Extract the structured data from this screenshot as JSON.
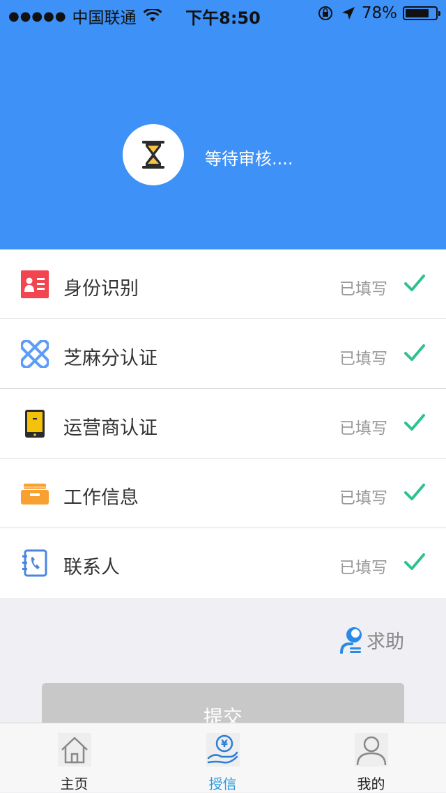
{
  "status_bar": {
    "signal": "●●●●●",
    "carrier": "中国联通",
    "time": "下午8:50",
    "battery": "78%",
    "battery_level": 0.78
  },
  "header": {
    "status_text": "等待审核....",
    "background_color": "#3d91f7",
    "icon": "hourglass-icon"
  },
  "items": [
    {
      "label": "身份识别",
      "state": "已填写",
      "icon": "id-card-icon",
      "icon_color": "#f2454f"
    },
    {
      "label": "芝麻分认证",
      "state": "已填写",
      "icon": "sesame-credit-icon",
      "icon_color": "#5b9df9"
    },
    {
      "label": "运营商认证",
      "state": "已填写",
      "icon": "mobile-phone-icon",
      "icon_color": "#f5c20b"
    },
    {
      "label": "工作信息",
      "state": "已填写",
      "icon": "briefcase-icon",
      "icon_color": "#f8a031"
    },
    {
      "label": "联系人",
      "state": "已填写",
      "icon": "contacts-book-icon",
      "icon_color": "#4a86e0"
    }
  ],
  "check_color": "#2ec28d",
  "help": {
    "label": "求助",
    "icon": "customer-service-icon"
  },
  "submit": {
    "label": "提交"
  },
  "tabbar": [
    {
      "label": "主页",
      "icon": "home-icon",
      "active": false
    },
    {
      "label": "授信",
      "icon": "credit-hand-icon",
      "active": true
    },
    {
      "label": "我的",
      "icon": "user-icon",
      "active": false
    }
  ]
}
